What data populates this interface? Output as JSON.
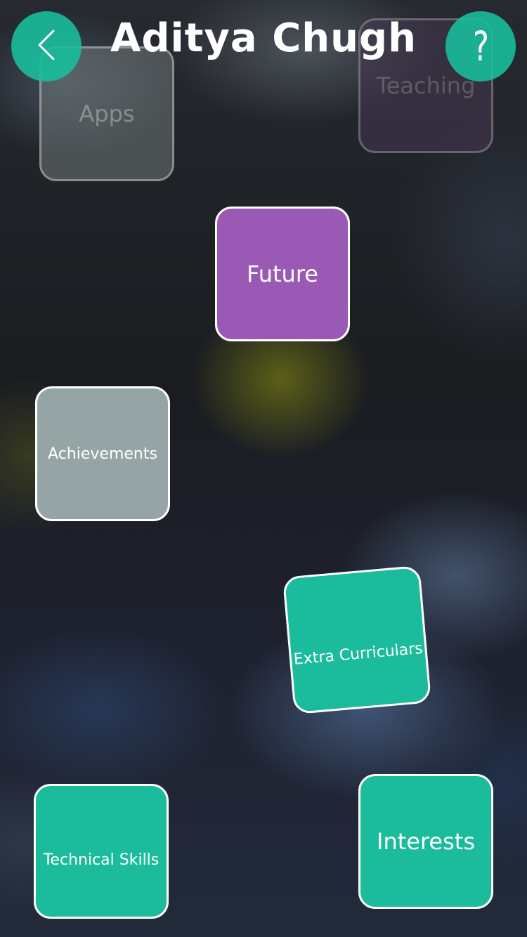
{
  "header": {
    "title": "Aditya Chugh",
    "back_icon": "chevron-left-icon",
    "help_label": "?",
    "accent_color": "#1abc9c"
  },
  "tiles": {
    "apps": {
      "label": "Apps",
      "state": "faded"
    },
    "teaching": {
      "label": "Teaching",
      "state": "faded"
    },
    "future": {
      "label": "Future",
      "color": "#9b59b6"
    },
    "achievements": {
      "label": "Achievements",
      "color": "#95a5a6"
    },
    "extra_curriculars": {
      "label": "Extra Curriculars",
      "color": "#1abc9c"
    },
    "technical_skills": {
      "label": "Technical Skills",
      "color": "#1abc9c"
    },
    "interests": {
      "label": "Interests",
      "color": "#1abc9c"
    }
  }
}
